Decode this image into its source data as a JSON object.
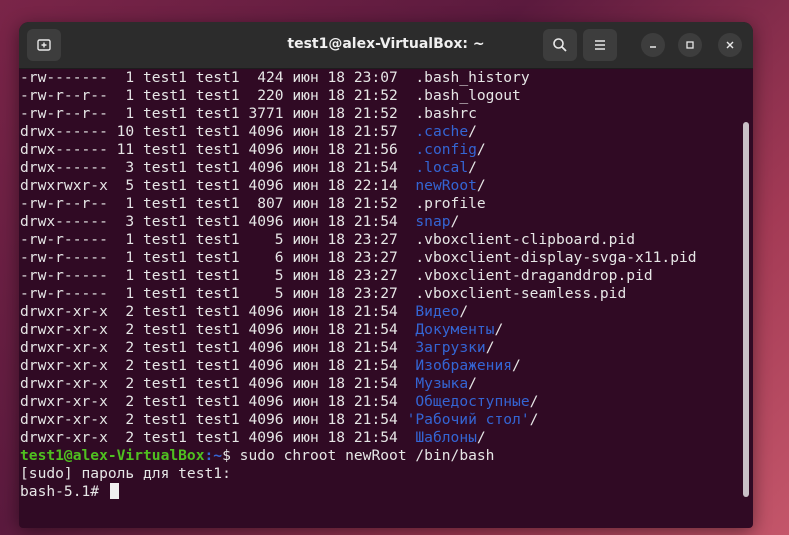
{
  "window": {
    "title": "test1@alex-VirtualBox: ~"
  },
  "listing": [
    {
      "perms": "-rw-------",
      "links": " 1",
      "owner": "test1",
      "group": "test1",
      "size": " 424",
      "month": "июн",
      "day": "18",
      "time": "23:07",
      "name": ".bash_history",
      "dir": false
    },
    {
      "perms": "-rw-r--r--",
      "links": " 1",
      "owner": "test1",
      "group": "test1",
      "size": " 220",
      "month": "июн",
      "day": "18",
      "time": "21:52",
      "name": ".bash_logout",
      "dir": false
    },
    {
      "perms": "-rw-r--r--",
      "links": " 1",
      "owner": "test1",
      "group": "test1",
      "size": "3771",
      "month": "июн",
      "day": "18",
      "time": "21:52",
      "name": ".bashrc",
      "dir": false
    },
    {
      "perms": "drwx------",
      "links": "10",
      "owner": "test1",
      "group": "test1",
      "size": "4096",
      "month": "июн",
      "day": "18",
      "time": "21:57",
      "name": ".cache",
      "dir": true
    },
    {
      "perms": "drwx------",
      "links": "11",
      "owner": "test1",
      "group": "test1",
      "size": "4096",
      "month": "июн",
      "day": "18",
      "time": "21:56",
      "name": ".config",
      "dir": true
    },
    {
      "perms": "drwx------",
      "links": " 3",
      "owner": "test1",
      "group": "test1",
      "size": "4096",
      "month": "июн",
      "day": "18",
      "time": "21:54",
      "name": ".local",
      "dir": true
    },
    {
      "perms": "drwxrwxr-x",
      "links": " 5",
      "owner": "test1",
      "group": "test1",
      "size": "4096",
      "month": "июн",
      "day": "18",
      "time": "22:14",
      "name": "newRoot",
      "dir": true
    },
    {
      "perms": "-rw-r--r--",
      "links": " 1",
      "owner": "test1",
      "group": "test1",
      "size": " 807",
      "month": "июн",
      "day": "18",
      "time": "21:52",
      "name": ".profile",
      "dir": false
    },
    {
      "perms": "drwx------",
      "links": " 3",
      "owner": "test1",
      "group": "test1",
      "size": "4096",
      "month": "июн",
      "day": "18",
      "time": "21:54",
      "name": "snap",
      "dir": true
    },
    {
      "perms": "-rw-r-----",
      "links": " 1",
      "owner": "test1",
      "group": "test1",
      "size": "   5",
      "month": "июн",
      "day": "18",
      "time": "23:27",
      "name": ".vboxclient-clipboard.pid",
      "dir": false
    },
    {
      "perms": "-rw-r-----",
      "links": " 1",
      "owner": "test1",
      "group": "test1",
      "size": "   6",
      "month": "июн",
      "day": "18",
      "time": "23:27",
      "name": ".vboxclient-display-svga-x11.pid",
      "dir": false
    },
    {
      "perms": "-rw-r-----",
      "links": " 1",
      "owner": "test1",
      "group": "test1",
      "size": "   5",
      "month": "июн",
      "day": "18",
      "time": "23:27",
      "name": ".vboxclient-draganddrop.pid",
      "dir": false
    },
    {
      "perms": "-rw-r-----",
      "links": " 1",
      "owner": "test1",
      "group": "test1",
      "size": "   5",
      "month": "июн",
      "day": "18",
      "time": "23:27",
      "name": ".vboxclient-seamless.pid",
      "dir": false
    },
    {
      "perms": "drwxr-xr-x",
      "links": " 2",
      "owner": "test1",
      "group": "test1",
      "size": "4096",
      "month": "июн",
      "day": "18",
      "time": "21:54",
      "name": "Видео",
      "dir": true
    },
    {
      "perms": "drwxr-xr-x",
      "links": " 2",
      "owner": "test1",
      "group": "test1",
      "size": "4096",
      "month": "июн",
      "day": "18",
      "time": "21:54",
      "name": "Документы",
      "dir": true
    },
    {
      "perms": "drwxr-xr-x",
      "links": " 2",
      "owner": "test1",
      "group": "test1",
      "size": "4096",
      "month": "июн",
      "day": "18",
      "time": "21:54",
      "name": "Загрузки",
      "dir": true
    },
    {
      "perms": "drwxr-xr-x",
      "links": " 2",
      "owner": "test1",
      "group": "test1",
      "size": "4096",
      "month": "июн",
      "day": "18",
      "time": "21:54",
      "name": "Изображения",
      "dir": true
    },
    {
      "perms": "drwxr-xr-x",
      "links": " 2",
      "owner": "test1",
      "group": "test1",
      "size": "4096",
      "month": "июн",
      "day": "18",
      "time": "21:54",
      "name": "Музыка",
      "dir": true
    },
    {
      "perms": "drwxr-xr-x",
      "links": " 2",
      "owner": "test1",
      "group": "test1",
      "size": "4096",
      "month": "июн",
      "day": "18",
      "time": "21:54",
      "name": "Общедоступные",
      "dir": true
    },
    {
      "perms": "drwxr-xr-x",
      "links": " 2",
      "owner": "test1",
      "group": "test1",
      "size": "4096",
      "month": "июн",
      "day": "18",
      "time": "21:54",
      "name": "'Рабочий стол'",
      "dir": true,
      "quoted": true
    },
    {
      "perms": "drwxr-xr-x",
      "links": " 2",
      "owner": "test1",
      "group": "test1",
      "size": "4096",
      "month": "июн",
      "day": "18",
      "time": "21:54",
      "name": "Шаблоны",
      "dir": true
    }
  ],
  "prompt": {
    "user_host": "test1@alex-VirtualBox",
    "path": ":~",
    "symbol": "$ ",
    "command": "sudo chroot newRoot /bin/bash"
  },
  "sudo_prompt": "[sudo] пароль для test1:",
  "bash_prompt": "bash-5.1# ",
  "colors": {
    "terminal_bg": "#300a24",
    "titlebar_bg": "#2c2c2c",
    "directory": "#3465d4",
    "prompt_user": "#4fc020",
    "text": "#e6e6e6"
  },
  "icons": {
    "new_tab": "new-tab-icon",
    "search": "search-icon",
    "menu": "hamburger-menu-icon",
    "minimize": "minimize-icon",
    "maximize": "maximize-icon",
    "close": "close-icon"
  }
}
